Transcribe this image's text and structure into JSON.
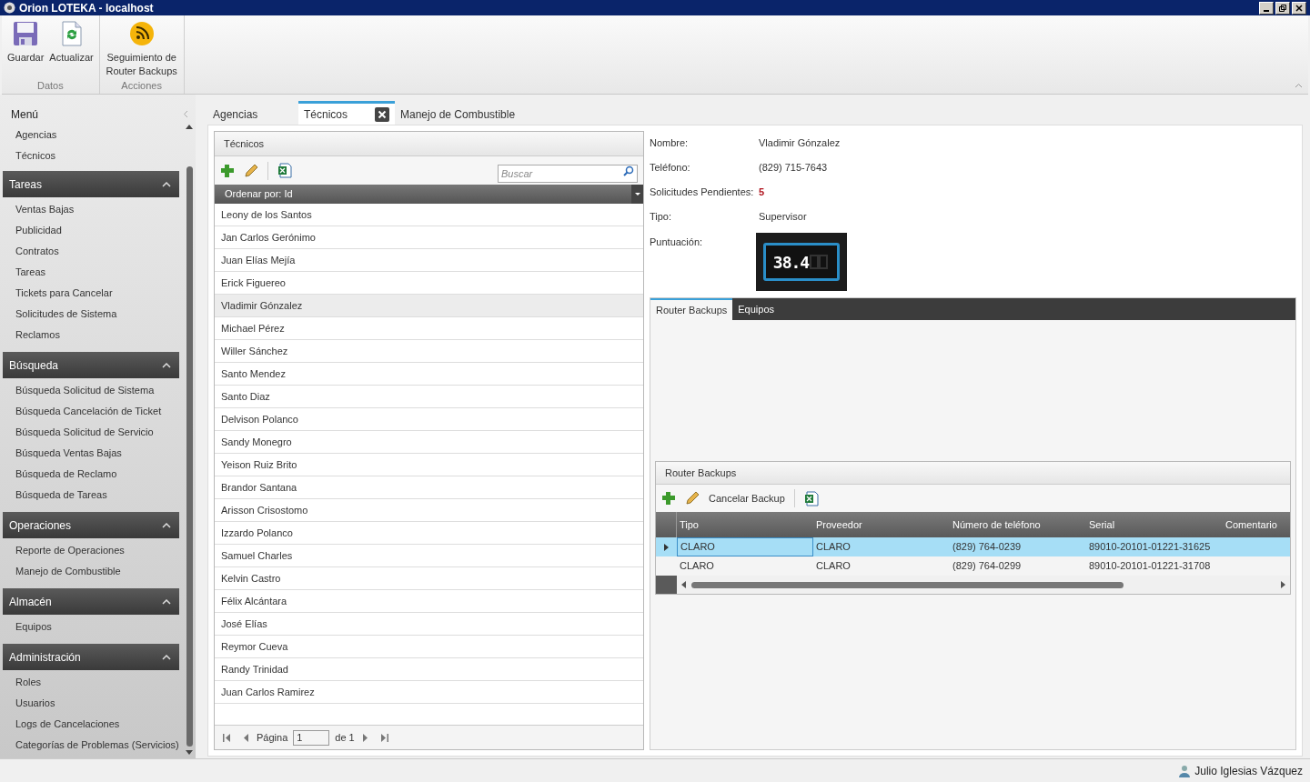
{
  "window": {
    "title": "Orion LOTEKA - localhost"
  },
  "ribbon": {
    "groups": [
      {
        "label": "Datos",
        "buttons": [
          {
            "label": "Guardar"
          },
          {
            "label": "Actualizar"
          }
        ]
      },
      {
        "label": "Acciones",
        "buttons": [
          {
            "label": "Seguimiento de Router Backups"
          }
        ]
      }
    ]
  },
  "sidebar": {
    "title": "Menú",
    "items": [
      "Agencias",
      "Técnicos"
    ],
    "sections": [
      {
        "title": "Tareas",
        "expanded": true,
        "items": [
          "Ventas Bajas",
          "Publicidad",
          "Contratos",
          "Tareas",
          "Tickets para Cancelar",
          "Solicitudes de Sistema",
          "Reclamos"
        ]
      },
      {
        "title": "Búsqueda",
        "expanded": true,
        "items": [
          "Búsqueda Solicitud de Sistema",
          "Búsqueda Cancelación de Ticket",
          "Búsqueda Solicitud de Servicio",
          "Búsqueda Ventas Bajas",
          "Búsqueda de Reclamo",
          "Búsqueda de Tareas"
        ]
      },
      {
        "title": "Operaciones",
        "expanded": true,
        "items": [
          "Reporte de Operaciones",
          "Manejo de Combustible"
        ]
      },
      {
        "title": "Almacén",
        "expanded": true,
        "items": [
          "Equipos"
        ]
      },
      {
        "title": "Administración",
        "expanded": true,
        "items": [
          "Roles",
          "Usuarios",
          "Logs de Cancelaciones",
          "Categorías de Problemas (Servicios)"
        ]
      }
    ]
  },
  "tabs": [
    {
      "label": "Agencias",
      "selected": false,
      "closable": false
    },
    {
      "label": "Técnicos",
      "selected": true,
      "closable": true
    },
    {
      "label": "Manejo de Combustible",
      "selected": false,
      "closable": false
    }
  ],
  "list": {
    "title": "Técnicos",
    "search": {
      "placeholder": "Buscar"
    },
    "sort": "Ordenar por: Id",
    "rows": [
      {
        "name": "Leony de los Santos",
        "selected": false
      },
      {
        "name": "Jan Carlos Gerónimo",
        "selected": false
      },
      {
        "name": "Juan Elías Mejía",
        "selected": false
      },
      {
        "name": "Erick Figuereo",
        "selected": false
      },
      {
        "name": "Vladimir Gónzalez",
        "selected": true
      },
      {
        "name": "Michael Pérez",
        "selected": false
      },
      {
        "name": "Willer Sánchez",
        "selected": false
      },
      {
        "name": "Santo Mendez",
        "selected": false
      },
      {
        "name": "Santo Diaz",
        "selected": false
      },
      {
        "name": "Delvison Polanco",
        "selected": false
      },
      {
        "name": "Sandy Monegro",
        "selected": false
      },
      {
        "name": "Yeison Ruiz Brito",
        "selected": false
      },
      {
        "name": "Brandor Santana",
        "selected": false
      },
      {
        "name": "Arisson Crisostomo",
        "selected": false
      },
      {
        "name": "Izzardo Polanco",
        "selected": false
      },
      {
        "name": "Samuel Charles",
        "selected": false
      },
      {
        "name": "Kelvin Castro",
        "selected": false
      },
      {
        "name": "Félix Alcántara",
        "selected": false
      },
      {
        "name": "José Elías",
        "selected": false
      },
      {
        "name": "Reymor Cueva",
        "selected": false
      },
      {
        "name": "Randy Trinidad",
        "selected": false
      },
      {
        "name": "Juan Carlos Ramirez",
        "selected": false
      }
    ],
    "pager": {
      "label": "Página",
      "value": "1",
      "total": "de 1"
    }
  },
  "details": {
    "fields": [
      {
        "label": "Nombre:",
        "value": "Vladimir Gónzalez",
        "kind": "text"
      },
      {
        "label": "Teléfono:",
        "value": "(829) 715-7643",
        "kind": "text"
      },
      {
        "label": "Solicitudes Pendientes:",
        "value": "5",
        "kind": "alert"
      },
      {
        "label": "Tipo:",
        "value": "Supervisor",
        "kind": "text"
      }
    ],
    "score": {
      "label": "Puntuación:",
      "value": "38.4"
    }
  },
  "subtabs": [
    {
      "label": "Router Backups",
      "selected": true
    },
    {
      "label": "Equipos",
      "selected": false
    }
  ],
  "backups": {
    "title": "Router Backups",
    "cancel_button": "Cancelar Backup",
    "columns": [
      "Tipo",
      "Proveedor",
      "Número de teléfono",
      "Serial",
      "Comentario"
    ],
    "rows": [
      {
        "cells": [
          "CLARO",
          "CLARO",
          "(829) 764-0239",
          "89010-20101-01221-31625"
        ],
        "selected": true
      },
      {
        "cells": [
          "CLARO",
          "CLARO",
          "(829) 764-0299",
          "89010-20101-01221-31708"
        ],
        "selected": false
      }
    ]
  },
  "status_bar": {
    "user": "Julio Iglesias Vázquez"
  }
}
